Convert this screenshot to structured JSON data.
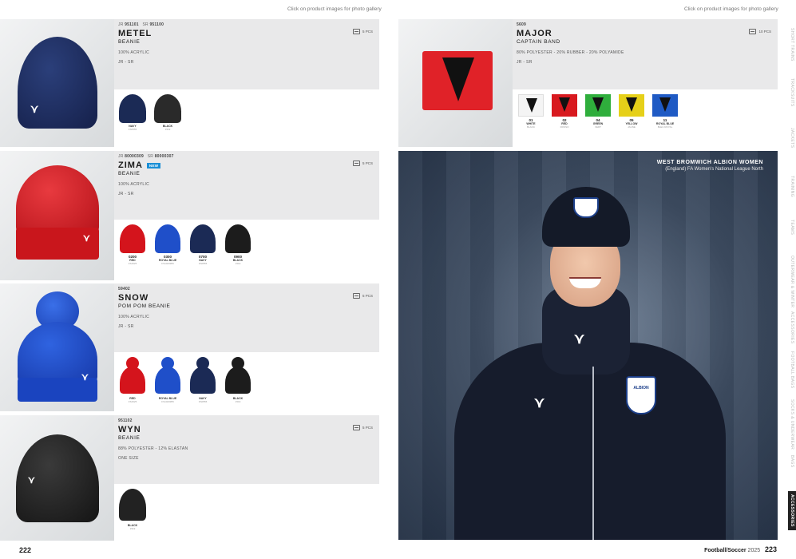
{
  "gallery_hint": "Click on product images for photo gallery",
  "footer": {
    "page_left": "222",
    "page_right": "223",
    "category": "Football/Soccer",
    "year": "2025"
  },
  "side_tabs": [
    "SHORT TRAINS",
    "TRACKSUITS",
    "JACKETS",
    "TRAINING",
    "TEAMS",
    "OUTERWEAR & WINTER",
    "ACCESSORIES",
    "FOOTBALL BAGS",
    "SOCKS & UNDERWEAR",
    "BAGS",
    "ACCESSORIES"
  ],
  "products": [
    {
      "codes": [
        {
          "label": "JR",
          "value": "951101"
        },
        {
          "label": "SR",
          "value": "951100"
        }
      ],
      "name": "METEL",
      "type": "BEANIE",
      "new": false,
      "new_label": "",
      "material": "100% ACRYLIC",
      "sizes": "JR - SR",
      "pcs": "5 PCS",
      "swatches": [
        {
          "code": "",
          "name": "NAVY",
          "sub": "FS0555",
          "color": "#1b2a55"
        },
        {
          "code": "",
          "name": "BLACK",
          "sub": "1519",
          "color": "#2a2a2a"
        }
      ]
    },
    {
      "codes": [
        {
          "label": "JR",
          "value": "80000309"
        },
        {
          "label": "SR",
          "value": "80000307"
        }
      ],
      "name": "ZIMA",
      "type": "BEANIE",
      "new": true,
      "new_label": "NEW",
      "material": "100% ACRYLIC",
      "sizes": "JR - SR",
      "pcs": "5 PCS",
      "swatches": [
        {
          "code": "0200",
          "name": "RED",
          "sub": "FS1525",
          "color": "#d4141c"
        },
        {
          "code": "0300",
          "name": "ROYAL BLUE",
          "sub": "FS1020955",
          "color": "#1f4fc9"
        },
        {
          "code": "0700",
          "name": "NAVY",
          "sub": "FS0555",
          "color": "#1b2a55"
        },
        {
          "code": "0900",
          "name": "BLACK",
          "sub": "1519",
          "color": "#1c1c1c"
        }
      ]
    },
    {
      "codes": [
        {
          "label": "",
          "value": "59402"
        }
      ],
      "name": "SNOW",
      "type": "POM POM BEANIE",
      "new": false,
      "new_label": "",
      "material": "100% ACRYLIC",
      "sizes": "JR - SR",
      "pcs": "5 PCS",
      "swatches": [
        {
          "code": "",
          "name": "RED",
          "sub": "FS1525",
          "color": "#d4141c"
        },
        {
          "code": "",
          "name": "ROYAL BLUE",
          "sub": "FS1020955",
          "color": "#1f4fc9"
        },
        {
          "code": "",
          "name": "NAVY",
          "sub": "FS0555",
          "color": "#1b2a55"
        },
        {
          "code": "",
          "name": "BLACK",
          "sub": "1519",
          "color": "#1c1c1c"
        }
      ]
    },
    {
      "codes": [
        {
          "label": "",
          "value": "951102"
        }
      ],
      "name": "WYN",
      "type": "BEANIE",
      "new": false,
      "new_label": "",
      "material": "88% POLYESTER - 12% ELASTAN",
      "sizes": "ONE SIZE",
      "pcs": "5 PCS",
      "swatches": [
        {
          "code": "",
          "name": "BLACK",
          "sub": "1519",
          "color": "#222"
        }
      ]
    }
  ],
  "major": {
    "code": "5609",
    "name": "MAJOR",
    "type": "CAPTAIN BAND",
    "material": "80% POLYESTER - 20% RUBBER - 20% POLYAMIDE",
    "sizes": "JR - SR",
    "pcs": "10 PCS",
    "swatches": [
      {
        "code": "01",
        "name": "WHITE",
        "sub": "BLANC",
        "color": "#f4f4f4"
      },
      {
        "code": "02",
        "name": "RED",
        "sub": "ROSSO",
        "color": "#d8191f"
      },
      {
        "code": "04",
        "name": "GREEN",
        "sub": "VERT",
        "color": "#2fae3c"
      },
      {
        "code": "05",
        "name": "YELLOW",
        "sub": "JAUNE",
        "color": "#e6d019"
      },
      {
        "code": "11",
        "name": "ROYAL BLUE",
        "sub": "BLEU ROYAL",
        "color": "#1f5ac4"
      }
    ]
  },
  "hero": {
    "title": "WEST BROMWICH ALBION WOMEN",
    "subtitle": "(England) FA Women's National League North",
    "crest_text": "ALBION"
  },
  "colors": {
    "accent_blue": "#1a8fd6",
    "light_panel": "#e9e9ea"
  }
}
